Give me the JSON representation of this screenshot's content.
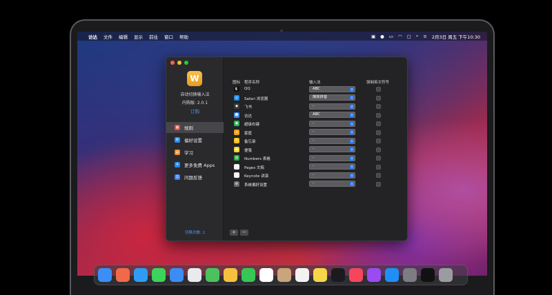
{
  "menubar": {
    "apple_glyph": "",
    "app_name": "访达",
    "items": [
      "文件",
      "编辑",
      "显示",
      "前往",
      "窗口",
      "帮助"
    ],
    "clock": "2月3日 周五 下午10:30"
  },
  "window": {
    "app_title": "自动切换输入法",
    "version": "内购版: 2.0.1",
    "subscribe": "订购",
    "icon_glyph": "W",
    "nav": [
      {
        "label": "规则",
        "active": true,
        "color": "#e84b3c",
        "glyph": "▦"
      },
      {
        "label": "偏好设置",
        "active": false,
        "color": "#2a8ff2",
        "glyph": "⚙"
      },
      {
        "label": "学习",
        "active": false,
        "color": "#f08a24",
        "glyph": "▤"
      },
      {
        "label": "更多免费 Apps",
        "active": false,
        "color": "#1b8cf0",
        "glyph": "A"
      },
      {
        "label": "问题反馈",
        "active": false,
        "color": "#3d7cf2",
        "glyph": "☺"
      }
    ],
    "switch_count": "切换次数: 2",
    "table": {
      "headers": [
        "图标",
        "程序名称",
        "输入法",
        "强制英文符号"
      ],
      "rows": [
        {
          "name": "QQ",
          "input": "ABC",
          "color": "#111111",
          "glyph": "🐧"
        },
        {
          "name": "Safari 浏览器",
          "input": "简体拼音",
          "color": "#1e88e5",
          "glyph": "◎"
        },
        {
          "name": "飞书",
          "input": "-",
          "color": "#3b3b3b",
          "glyph": "◆"
        },
        {
          "name": "访达",
          "input": "ABC",
          "color": "#3a8ef6",
          "glyph": "☻"
        },
        {
          "name": "超级右键",
          "input": "-",
          "color": "#2fb55a",
          "glyph": "◉"
        },
        {
          "name": "家庭",
          "input": "-",
          "color": "#f2a21c",
          "glyph": "⌂"
        },
        {
          "name": "备忘录",
          "input": "-",
          "color": "#f5c518",
          "glyph": "✎"
        },
        {
          "name": "便笺",
          "input": "-",
          "color": "#f2d43a",
          "glyph": "▬"
        },
        {
          "name": "Numbers 表格",
          "input": "-",
          "color": "#28a745",
          "glyph": "▥"
        },
        {
          "name": "Pages 文稿",
          "input": "-",
          "color": "#f2f2f2",
          "glyph": "✐"
        },
        {
          "name": "Keynote 讲演",
          "input": "-",
          "color": "#f2f2f2",
          "glyph": "▲"
        },
        {
          "name": "系统偏好设置",
          "input": "-",
          "color": "#6b6b70",
          "glyph": "⚙"
        }
      ]
    },
    "add_label": "+",
    "remove_label": "−"
  },
  "dock": {
    "apps": [
      {
        "name": "Finder",
        "color": "#3a8ef6"
      },
      {
        "name": "Launchpad",
        "color": "#f06a4a"
      },
      {
        "name": "Safari",
        "color": "#2e9cf4"
      },
      {
        "name": "Messages",
        "color": "#3cd35a"
      },
      {
        "name": "Mail",
        "color": "#3c8df2"
      },
      {
        "name": "Photos",
        "color": "#e9e9ee"
      },
      {
        "name": "Maps",
        "color": "#4cc25e"
      },
      {
        "name": "Photos2",
        "color": "#f6c23e"
      },
      {
        "name": "FaceTime",
        "color": "#37c755"
      },
      {
        "name": "Calendar",
        "color": "#ffffff"
      },
      {
        "name": "Contacts",
        "color": "#c8a57a"
      },
      {
        "name": "Reminders",
        "color": "#f2f2f2"
      },
      {
        "name": "Notes",
        "color": "#f7d54a"
      },
      {
        "name": "TV",
        "color": "#1b1b1f"
      },
      {
        "name": "Music",
        "color": "#f5465c"
      },
      {
        "name": "Podcasts",
        "color": "#9b4cf0"
      },
      {
        "name": "App Store",
        "color": "#1f8ff5"
      },
      {
        "name": "System Preferences",
        "color": "#7c7c82"
      },
      {
        "name": "QQ",
        "color": "#111111"
      },
      {
        "name": "Trash",
        "color": "#9b9ba0"
      }
    ]
  }
}
